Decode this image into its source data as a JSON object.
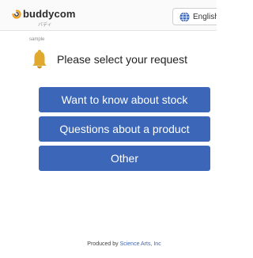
{
  "header": {
    "logo_text": "buddycom",
    "logo_sub": "バディ",
    "language_label": "English"
  },
  "main": {
    "sample_label": "sample",
    "prompt": "Please select your request",
    "options": [
      {
        "label": "Want to know about stock"
      },
      {
        "label": "Questions about a product"
      },
      {
        "label": "Other"
      }
    ]
  },
  "footer": {
    "produced_by": "Produced by",
    "company": "Science Arts, Inc"
  },
  "colors": {
    "button_blue": "#3c67b8",
    "bell_yellow": "#e0a82e"
  },
  "icons": [
    "buddycom-logo-icon",
    "globe-icon",
    "bell-icon"
  ]
}
